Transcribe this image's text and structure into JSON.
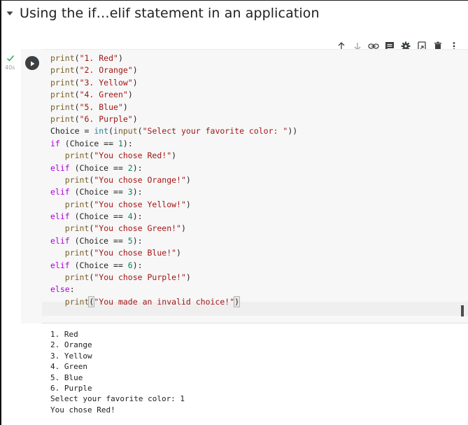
{
  "section": {
    "title": "Using the if…elif statement in an application"
  },
  "toolbar": {
    "icons": [
      "arrow-up-icon",
      "arrow-down-icon",
      "link-icon",
      "comment-icon",
      "gear-icon",
      "mirror-cell-icon",
      "trash-icon",
      "more-vert-icon"
    ]
  },
  "cell": {
    "status_time": "40s",
    "run_icon": "play-icon",
    "code_lines": [
      [
        {
          "c": "fn",
          "t": "print"
        },
        {
          "c": "txt",
          "t": "("
        },
        {
          "c": "str",
          "t": "\"1. Red\""
        },
        {
          "c": "txt",
          "t": ")"
        }
      ],
      [
        {
          "c": "fn",
          "t": "print"
        },
        {
          "c": "txt",
          "t": "("
        },
        {
          "c": "str",
          "t": "\"2. Orange\""
        },
        {
          "c": "txt",
          "t": ")"
        }
      ],
      [
        {
          "c": "fn",
          "t": "print"
        },
        {
          "c": "txt",
          "t": "("
        },
        {
          "c": "str",
          "t": "\"3. Yellow\""
        },
        {
          "c": "txt",
          "t": ")"
        }
      ],
      [
        {
          "c": "fn",
          "t": "print"
        },
        {
          "c": "txt",
          "t": "("
        },
        {
          "c": "str",
          "t": "\"4. Green\""
        },
        {
          "c": "txt",
          "t": ")"
        }
      ],
      [
        {
          "c": "fn",
          "t": "print"
        },
        {
          "c": "txt",
          "t": "("
        },
        {
          "c": "str",
          "t": "\"5. Blue\""
        },
        {
          "c": "txt",
          "t": ")"
        }
      ],
      [
        {
          "c": "fn",
          "t": "print"
        },
        {
          "c": "txt",
          "t": "("
        },
        {
          "c": "str",
          "t": "\"6. Purple\""
        },
        {
          "c": "txt",
          "t": ")"
        }
      ],
      [
        {
          "c": "txt",
          "t": "Choice = "
        },
        {
          "c": "bi",
          "t": "int"
        },
        {
          "c": "txt",
          "t": "("
        },
        {
          "c": "fn",
          "t": "input"
        },
        {
          "c": "txt",
          "t": "("
        },
        {
          "c": "str",
          "t": "\"Select your favorite color: \""
        },
        {
          "c": "txt",
          "t": "))"
        }
      ],
      [
        {
          "c": "kw",
          "t": "if"
        },
        {
          "c": "txt",
          "t": " (Choice == "
        },
        {
          "c": "num",
          "t": "1"
        },
        {
          "c": "txt",
          "t": "):"
        }
      ],
      [
        {
          "c": "txt",
          "t": "   "
        },
        {
          "c": "fn",
          "t": "print"
        },
        {
          "c": "txt",
          "t": "("
        },
        {
          "c": "str",
          "t": "\"You chose Red!\""
        },
        {
          "c": "txt",
          "t": ")"
        }
      ],
      [
        {
          "c": "kw",
          "t": "elif"
        },
        {
          "c": "txt",
          "t": " (Choice == "
        },
        {
          "c": "num",
          "t": "2"
        },
        {
          "c": "txt",
          "t": "):"
        }
      ],
      [
        {
          "c": "txt",
          "t": "   "
        },
        {
          "c": "fn",
          "t": "print"
        },
        {
          "c": "txt",
          "t": "("
        },
        {
          "c": "str",
          "t": "\"You chose Orange!\""
        },
        {
          "c": "txt",
          "t": ")"
        }
      ],
      [
        {
          "c": "kw",
          "t": "elif"
        },
        {
          "c": "txt",
          "t": " (Choice == "
        },
        {
          "c": "num",
          "t": "3"
        },
        {
          "c": "txt",
          "t": "):"
        }
      ],
      [
        {
          "c": "txt",
          "t": "   "
        },
        {
          "c": "fn",
          "t": "print"
        },
        {
          "c": "txt",
          "t": "("
        },
        {
          "c": "str",
          "t": "\"You chose Yellow!\""
        },
        {
          "c": "txt",
          "t": ")"
        }
      ],
      [
        {
          "c": "kw",
          "t": "elif"
        },
        {
          "c": "txt",
          "t": " (Choice == "
        },
        {
          "c": "num",
          "t": "4"
        },
        {
          "c": "txt",
          "t": "):"
        }
      ],
      [
        {
          "c": "txt",
          "t": "   "
        },
        {
          "c": "fn",
          "t": "print"
        },
        {
          "c": "txt",
          "t": "("
        },
        {
          "c": "str",
          "t": "\"You chose Green!\""
        },
        {
          "c": "txt",
          "t": ")"
        }
      ],
      [
        {
          "c": "kw",
          "t": "elif"
        },
        {
          "c": "txt",
          "t": " (Choice == "
        },
        {
          "c": "num",
          "t": "5"
        },
        {
          "c": "txt",
          "t": "):"
        }
      ],
      [
        {
          "c": "txt",
          "t": "   "
        },
        {
          "c": "fn",
          "t": "print"
        },
        {
          "c": "txt",
          "t": "("
        },
        {
          "c": "str",
          "t": "\"You chose Blue!\""
        },
        {
          "c": "txt",
          "t": ")"
        }
      ],
      [
        {
          "c": "kw",
          "t": "elif"
        },
        {
          "c": "txt",
          "t": " (Choice == "
        },
        {
          "c": "num",
          "t": "6"
        },
        {
          "c": "txt",
          "t": "):"
        }
      ],
      [
        {
          "c": "txt",
          "t": "   "
        },
        {
          "c": "fn",
          "t": "print"
        },
        {
          "c": "txt",
          "t": "("
        },
        {
          "c": "str",
          "t": "\"You chose Purple!\""
        },
        {
          "c": "txt",
          "t": ")"
        }
      ],
      [
        {
          "c": "kw",
          "t": "else"
        },
        {
          "c": "txt",
          "t": ":"
        }
      ],
      [
        {
          "c": "txt",
          "t": "   "
        },
        {
          "c": "fn",
          "t": "print"
        },
        {
          "c": "bm",
          "t": "("
        },
        {
          "c": "str",
          "t": "\"You made an invalid choice!\""
        },
        {
          "c": "bm",
          "t": ")"
        }
      ]
    ]
  },
  "output": {
    "lines": [
      "1. Red",
      "2. Orange",
      "3. Yellow",
      "4. Green",
      "5. Blue",
      "6. Purple",
      "Select your favorite color: 1",
      "You chose Red!"
    ]
  },
  "colors": {
    "keyword": "#af00db",
    "function": "#795e26",
    "builtin": "#267f99",
    "string": "#a31515",
    "number": "#098658",
    "success": "#34a853"
  }
}
